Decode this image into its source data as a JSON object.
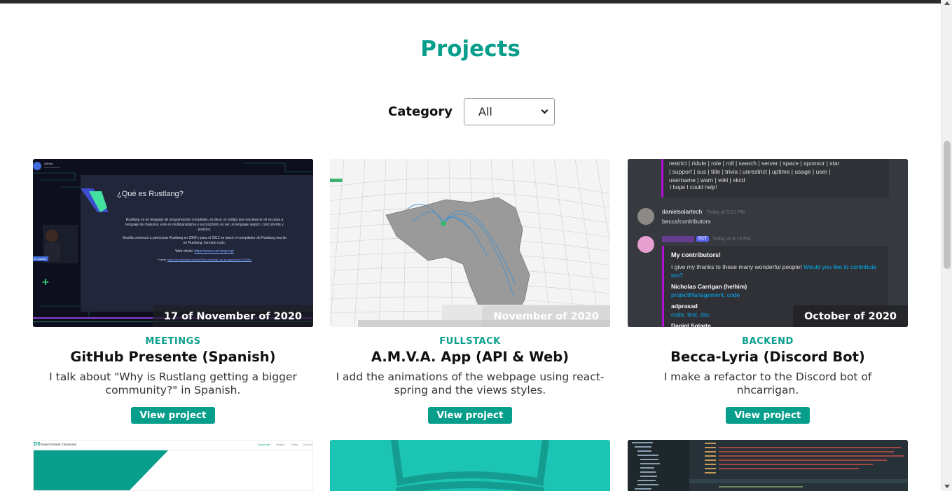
{
  "page": {
    "title": "Projects"
  },
  "filter": {
    "label": "Category",
    "selected": "All"
  },
  "projects": [
    {
      "category": "MEETINGS",
      "title": "GitHub Presente (Spanish)",
      "description": "I talk about \"Why is Rustlang getting a bigger community?\" in Spanish.",
      "date": "17 of November of 2020",
      "button": "View project",
      "slide": {
        "heading": "¿Qué es Rustlang?",
        "para1": "Rustlang es un lenguaje de programación compilado, es decir, el código que escribas en él se pasa a lenguaje de máquina; este es multiparadigma y su propósito es ser un lenguaje seguro, concurrente y práctico.",
        "para2": "Mozilla comenzó a patrocinar Rustlang en 2009 y para el 2012 se lanzó el compilador de Rustlang escrito en Rustlang, llamado rustc.",
        "link_label": "Web oficial:",
        "link": "https://www.rust-lang.org/",
        "source_label": "Fuente:",
        "source": "https://es.wikipedia.org/wiki/Rust_(lenguaje_de_programaci%C3%B3n)",
        "speaker_tag": "el Solarte",
        "host_name": "GitHub",
        "host_sub": "GitHub Presente"
      }
    },
    {
      "category": "FULLSTACK",
      "title": "A.M.V.A. App (API & Web)",
      "description": "I add the animations of the webpage using react-spring and the views styles.",
      "date": "November of 2020",
      "button": "View project"
    },
    {
      "category": "BACKEND",
      "title": "Becca-Lyria (Discord Bot)",
      "description": "I make a refactor to the Discord bot of nhcarrigan.",
      "date": "October of 2020",
      "button": "View project",
      "discord": {
        "cmd_line1": "restrict | ridule | role | roll | search | server | space | sponsor | star",
        "cmd_line2": "| support | sus | title | trivia | unrestrict | uptime | usage | user |",
        "cmd_line3": "username | warn | wiki | xkcd",
        "hope": "I hope I could help!",
        "user1": "danielsolartech",
        "user1_time": "Today at 9:15 PM",
        "user1_msg": "becca!contributors",
        "bot_badge": "BOT",
        "bot_time": "Today at 9:15 PM",
        "embed_title": "My contributors!",
        "embed_thanks": "I give my thanks to these many wonderful people!",
        "embed_link": "Would you like to contribute too?",
        "c1_name": "Nicholas Carrigan (he/him)",
        "c1_roles": "projectManagement, code",
        "c2_name": "adprasad",
        "c2_roles": "code, test, doc",
        "c3_name": "Daniel Solarte"
      }
    }
  ],
  "next_row": {
    "site_logo": "DS",
    "site_name": "Daniel Solarte Chasseras",
    "nav": [
      "About me",
      "Project",
      "Skills",
      "Contact"
    ]
  },
  "colors": {
    "accent": "#089e8c",
    "slide_bg": "#1f2236",
    "discord_bg": "#36393f"
  }
}
